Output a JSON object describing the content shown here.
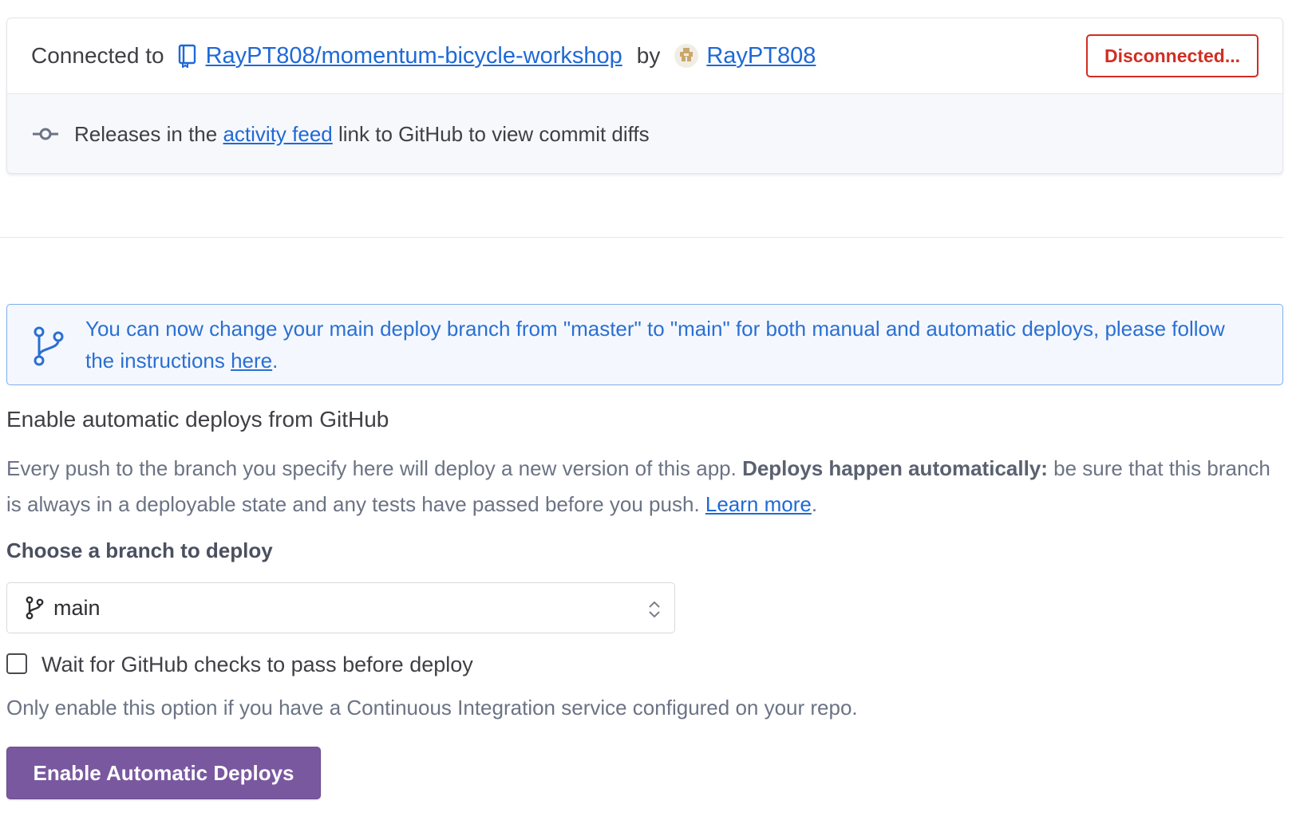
{
  "connection": {
    "prefix": "Connected to",
    "repo": "RayPT808/momentum-bicycle-workshop",
    "by": "by",
    "user": "RayPT808",
    "disconnect_label": "Disconnected..."
  },
  "releases": {
    "prefix": "Releases in the",
    "link": "activity feed",
    "suffix": "link to GitHub to view commit diffs"
  },
  "banner": {
    "text": "You can now change your main deploy branch from \"master\" to \"main\" for both manual and automatic deploys, please follow the instructions ",
    "link": "here",
    "end": "."
  },
  "auto_deploy": {
    "title": "Enable automatic deploys from GitHub",
    "desc_start": "Every push to the branch you specify here will deploy a new version of this app. ",
    "desc_bold": "Deploys happen automatically:",
    "desc_end": " be sure that this branch is always in a deployable state and any tests have passed before you push. ",
    "learn_more": "Learn more",
    "desc_period": ".",
    "branch_label": "Choose a branch to deploy",
    "branch_value": "main",
    "checkbox_label": "Wait for GitHub checks to pass before deploy",
    "checkbox_checked": false,
    "help_text": "Only enable this option if you have a Continuous Integration service configured on your repo.",
    "enable_button": "Enable Automatic Deploys"
  },
  "colors": {
    "link": "#1f69d6",
    "danger": "#d02e23",
    "primary_button": "#79589f",
    "banner_border": "#7eaee8",
    "banner_text": "#2b6fd3"
  }
}
